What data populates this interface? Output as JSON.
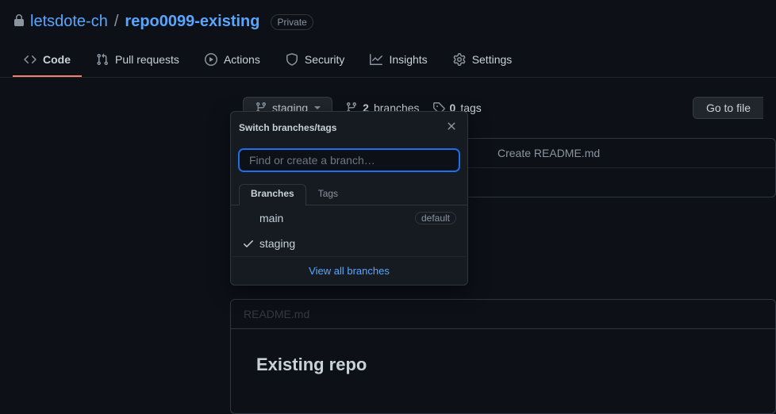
{
  "repo": {
    "owner": "letsdote-ch",
    "name": "repo0099-existing",
    "visibility": "Private"
  },
  "nav": {
    "code": "Code",
    "pulls": "Pull requests",
    "actions": "Actions",
    "security": "Security",
    "insights": "Insights",
    "settings": "Settings"
  },
  "toolbar": {
    "current_branch": "staging",
    "branches_count": "2",
    "branches_label": "branches",
    "tags_count": "0",
    "tags_label": "tags",
    "goto_file": "Go to file"
  },
  "popover": {
    "title": "Switch branches/tags",
    "search_placeholder": "Find or create a branch…",
    "tab_branches": "Branches",
    "tab_tags": "Tags",
    "items": [
      {
        "name": "main",
        "default": "default",
        "selected": false
      },
      {
        "name": "staging",
        "default": "",
        "selected": true
      }
    ],
    "view_all": "View all branches"
  },
  "content": {
    "commit_message": "Create README.md",
    "readme_filename": "README.md",
    "readme_heading": "Existing repo"
  }
}
